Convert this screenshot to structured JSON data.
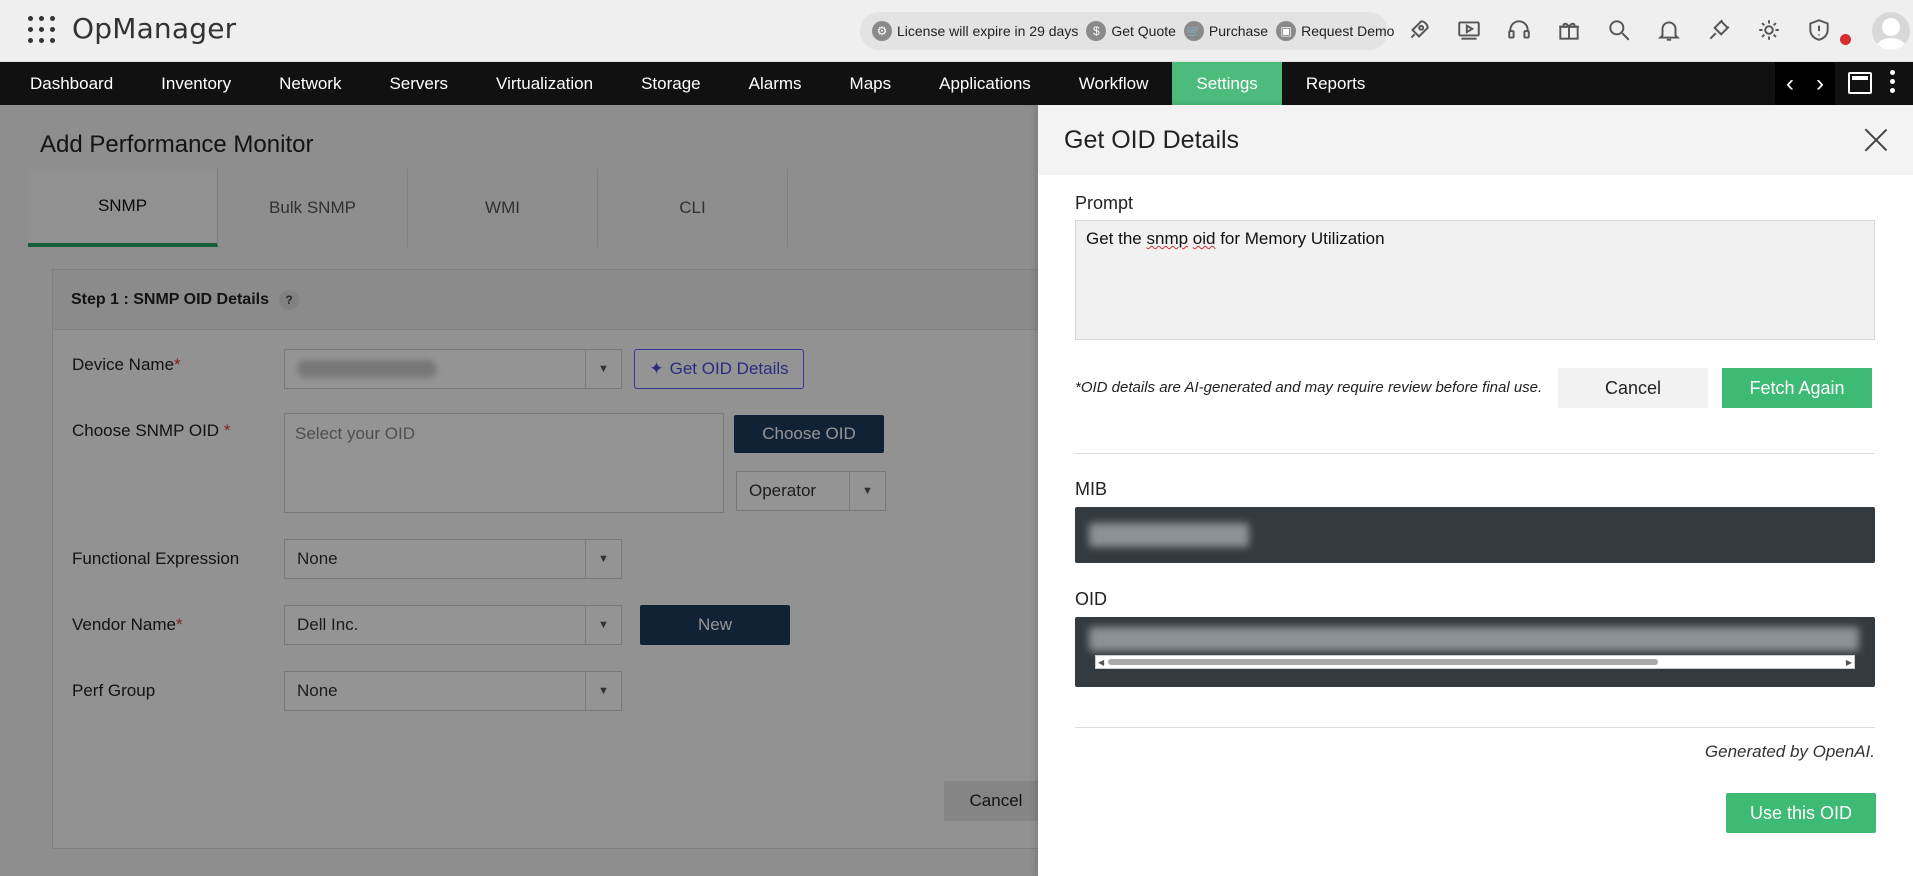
{
  "app": {
    "title": "OpManager"
  },
  "promo": {
    "license": "License will expire in 29 days",
    "quote": "Get Quote",
    "purchase": "Purchase",
    "demo": "Request Demo"
  },
  "nav": {
    "items": [
      "Dashboard",
      "Inventory",
      "Network",
      "Servers",
      "Virtualization",
      "Storage",
      "Alarms",
      "Maps",
      "Applications",
      "Workflow",
      "Settings",
      "Reports"
    ],
    "active": "Settings"
  },
  "page": {
    "title": "Add Performance Monitor",
    "tabs": [
      "SNMP",
      "Bulk SNMP",
      "WMI",
      "CLI"
    ],
    "step_title": "Step 1 : SNMP OID Details",
    "help": "?",
    "device_name_label": "Device Name",
    "get_oid_button": "Get OID Details",
    "choose_oid_label": "Choose SNMP OID",
    "oid_placeholder": "Select your OID",
    "choose_oid_button": "Choose OID",
    "operator": "Operator",
    "functional_expression_label": "Functional Expression",
    "functional_expression_value": "None",
    "vendor_name_label": "Vendor Name",
    "vendor_name_value": "Dell Inc.",
    "new_button": "New",
    "perf_group_label": "Perf Group",
    "perf_group_value": "None",
    "cancel_button": "Cancel",
    "required_mark": "*"
  },
  "drawer": {
    "title": "Get OID Details",
    "prompt_label": "Prompt",
    "prompt_prefix": "Get the ",
    "prompt_squiggle_1": "snmp",
    "prompt_space": " ",
    "prompt_squiggle_2": "oid",
    "prompt_suffix": " for Memory Utilization",
    "note": "*OID details are AI-generated and may require review before final use.",
    "cancel_button": "Cancel",
    "fetch_button": "Fetch Again",
    "mib_label": "MIB",
    "oid_label": "OID",
    "generated_by": "Generated by OpenAI.",
    "use_button": "Use this OID"
  },
  "colors": {
    "accent_green": "#3dba74",
    "nav_active": "#4cbb7b",
    "dark_field": "#333a40",
    "button_dark": "#1f3b5e"
  }
}
